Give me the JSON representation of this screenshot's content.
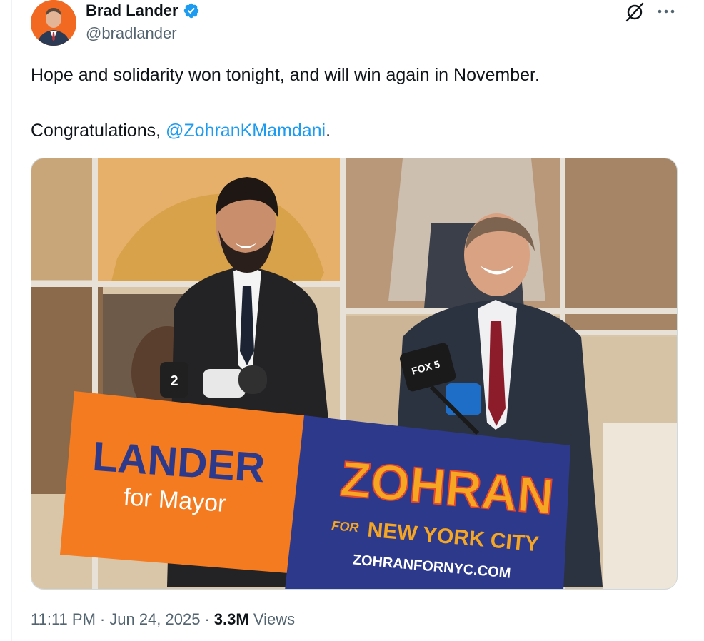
{
  "author": {
    "name": "Brad Lander",
    "handle": "@bradlander"
  },
  "post": {
    "line1": "Hope and solidarity won tonight, and will win again in November.",
    "line2_prefix": "Congratulations, ",
    "mention": "@ZohranKMamdani",
    "line2_suffix": "."
  },
  "media": {
    "sign_left_line1": "LANDER",
    "sign_left_line2": "for Mayor",
    "sign_right_line1": "ZOHRAN",
    "sign_right_for": "FOR",
    "sign_right_line2": "NEW YORK CITY",
    "sign_right_url": "ZOHRANFORNYC.COM",
    "mic_label_1": "2",
    "mic_label_2": "FOX 5"
  },
  "meta": {
    "time": "11:11 PM",
    "sep1": "·",
    "date": "Jun 24, 2025",
    "sep2": "·",
    "views_count": "3.3M",
    "views_label": "Views"
  },
  "colors": {
    "verified": "#1d9bf0",
    "mention": "#1d9bf0",
    "sign_orange": "#f47b20",
    "sign_blue": "#2d3a8c",
    "zohran_orange": "#f5a623",
    "zohran_red": "#e5452b"
  },
  "icons": {
    "verified": "verified-badge-icon",
    "grok": "grok-icon",
    "more": "more-dots-icon"
  }
}
